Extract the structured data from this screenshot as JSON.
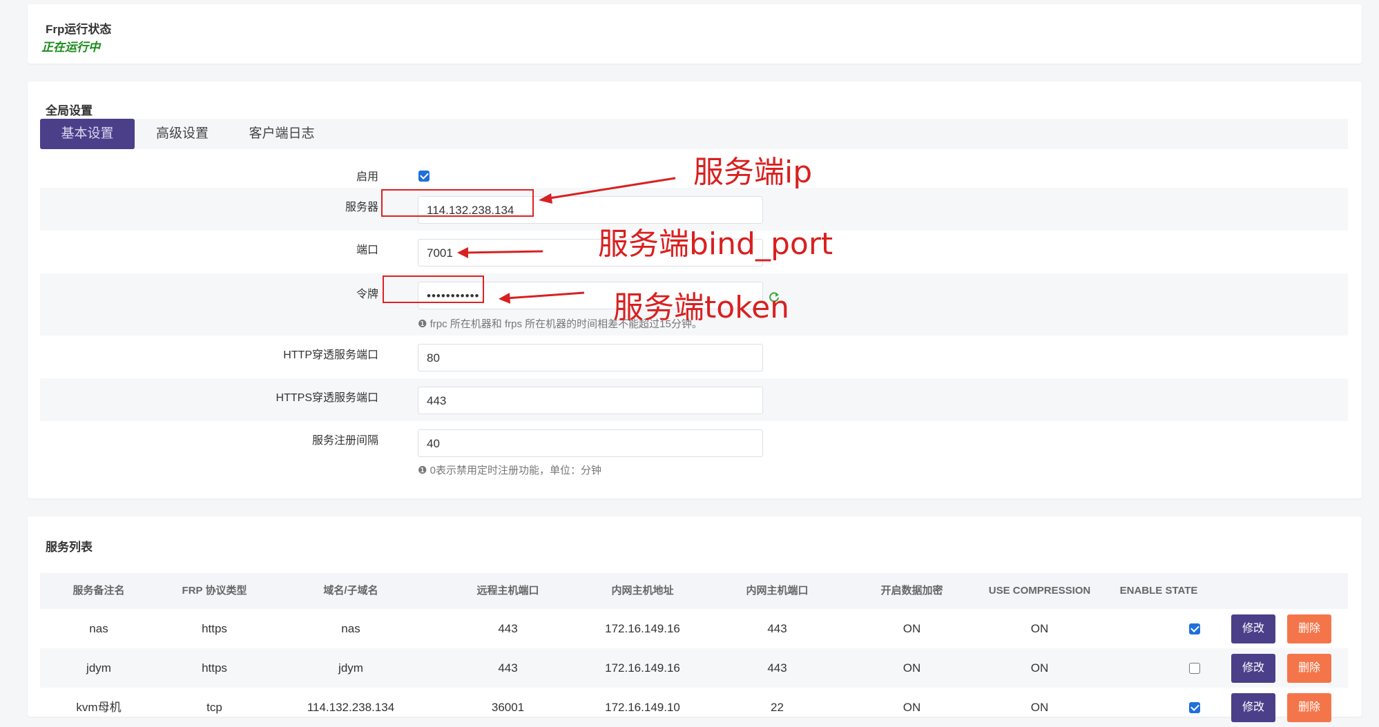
{
  "status": {
    "title": "Frp运行状态",
    "value": "正在运行中"
  },
  "global": {
    "title": "全局设置",
    "tabs": [
      {
        "label": "基本设置",
        "active": true
      },
      {
        "label": "高级设置",
        "active": false
      },
      {
        "label": "客户端日志",
        "active": false
      }
    ],
    "fields": {
      "enable_label": "启用",
      "enable_checked": true,
      "server_label": "服务器",
      "server_value": "114.132.238.134",
      "port_label": "端口",
      "port_value": "7001",
      "token_label": "令牌",
      "token_value": "•••••••••••",
      "token_hint": "frpc 所在机器和 frps 所在机器的时间相差不能超过15分钟。",
      "http_label": "HTTP穿透服务端口",
      "http_value": "80",
      "https_label": "HTTPS穿透服务端口",
      "https_value": "443",
      "interval_label": "服务注册间隔",
      "interval_value": "40",
      "interval_hint": "0表示禁用定时注册功能，单位：分钟"
    }
  },
  "annotations": {
    "server_ip": "服务端ip",
    "bind_port": "服务端bind_port",
    "token": "服务端token",
    "color": "#d92020"
  },
  "services": {
    "title": "服务列表",
    "columns": [
      "服务备注名",
      "FRP 协议类型",
      "域名/子域名",
      "远程主机端口",
      "内网主机地址",
      "内网主机端口",
      "开启数据加密",
      "USE COMPRESSION",
      "ENABLE STATE"
    ],
    "edit_label": "修改",
    "delete_label": "删除",
    "rows": [
      {
        "name": "nas",
        "protocol": "https",
        "domain": "nas",
        "remote_port": "443",
        "local_ip": "172.16.149.16",
        "local_port": "443",
        "encryption": "ON",
        "compression": "ON",
        "enabled": true
      },
      {
        "name": "jdym",
        "protocol": "https",
        "domain": "jdym",
        "remote_port": "443",
        "local_ip": "172.16.149.16",
        "local_port": "443",
        "encryption": "ON",
        "compression": "ON",
        "enabled": false
      },
      {
        "name": "kvm母机",
        "protocol": "tcp",
        "domain": "114.132.238.134",
        "remote_port": "36001",
        "local_ip": "172.16.149.10",
        "local_port": "22",
        "encryption": "ON",
        "compression": "ON",
        "enabled": true
      }
    ]
  },
  "colors": {
    "accent": "#4b3f8a",
    "danger": "#f4754a",
    "running": "#1a8a1a",
    "checkbox": "#1f6fdc"
  }
}
